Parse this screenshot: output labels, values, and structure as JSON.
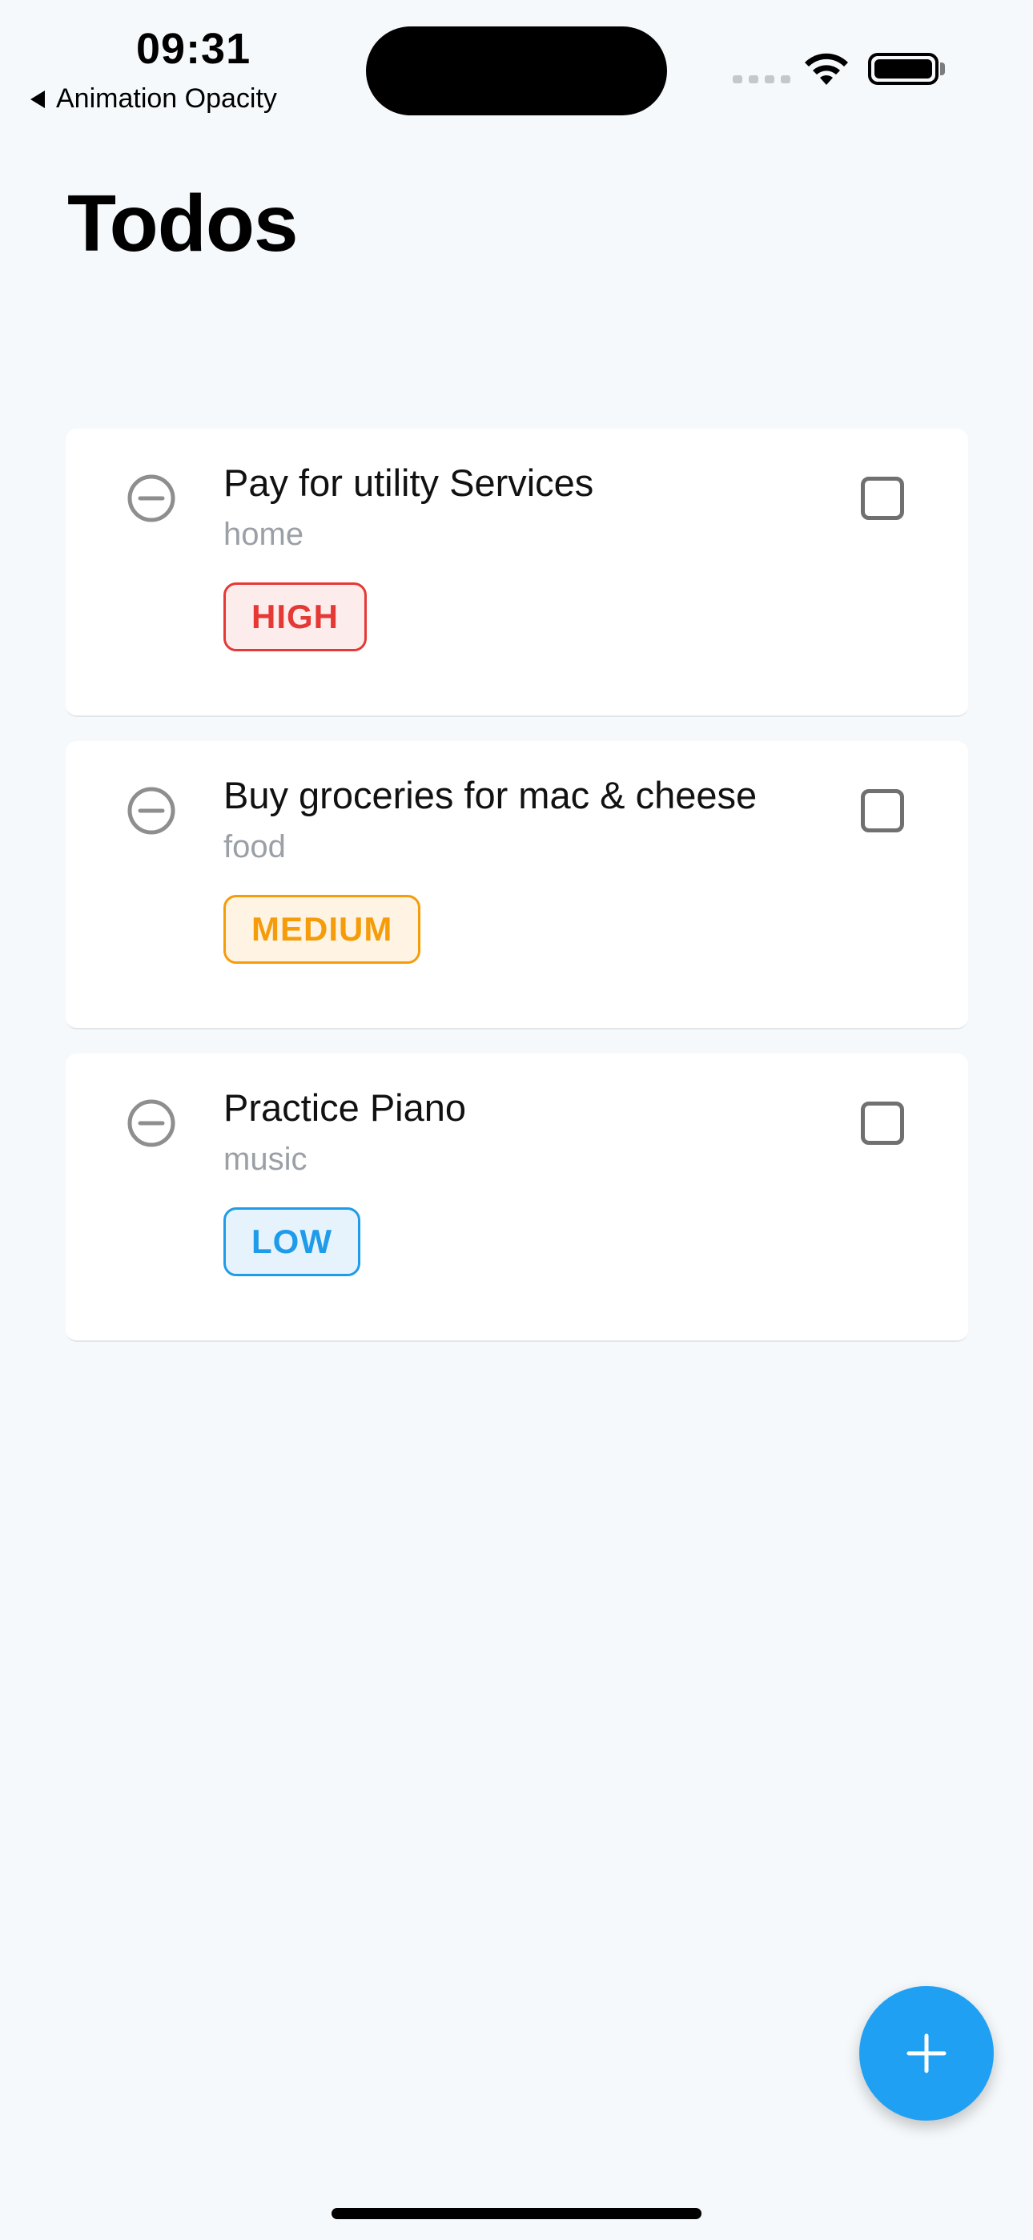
{
  "status_bar": {
    "time": "09:31",
    "back_label": "Animation Opacity"
  },
  "page": {
    "title": "Todos"
  },
  "todos": [
    {
      "title": "Pay for utility Services",
      "category": "home",
      "priority": "HIGH",
      "colors": {
        "text": "#e53935",
        "border": "#e53935",
        "bg": "#fdecec"
      }
    },
    {
      "title": "Buy groceries for mac & cheese",
      "category": "food",
      "priority": "MEDIUM",
      "colors": {
        "text": "#f59c0b",
        "border": "#f59c0b",
        "bg": "#fff4e3"
      }
    },
    {
      "title": "Practice Piano",
      "category": "music",
      "priority": "LOW",
      "colors": {
        "text": "#1e9be9",
        "border": "#1e9be9",
        "bg": "#e6f3fc"
      }
    }
  ],
  "fab": {
    "icon": "plus-icon",
    "color": "#20a0f3"
  }
}
